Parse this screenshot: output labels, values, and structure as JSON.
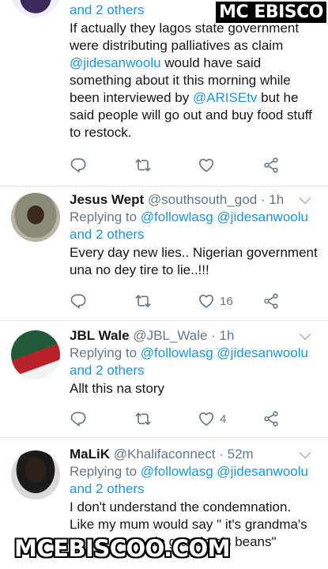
{
  "watermarks": {
    "top": "MC EBISCO",
    "bottom": "MCEBISCOO.COM"
  },
  "tweet1": {
    "reply_tail": "and 2 others",
    "body_1": "If actually they lagos state government were distributing palliatives as claim ",
    "mention_1": "@jidesanwoolu",
    "body_2": " would have said something about it this morning while been interviewed by ",
    "mention_2": "@ARISEtv",
    "body_3": " but he said people will go out and buy food stuff to restock."
  },
  "tweet2": {
    "name": "Jesus Wept",
    "handle": "@southsouth_god",
    "time": "· 1h",
    "replying": "Replying to ",
    "mention_1": "@followlasg",
    "mention_2": "@jidesanwoolu",
    "reply_tail": "and 2 others",
    "body": "Every day new lies.. Nigerian government una no dey tire to lie..!!!",
    "likes": "16"
  },
  "tweet3": {
    "name": "JBL Wale",
    "handle": "@JBL_Wale",
    "time": "· 1h",
    "replying": "Replying to ",
    "mention_1": "@followlasg",
    "mention_2": "@jidesanwoolu",
    "reply_tail": "and 2 others",
    "body": "Allt this na story",
    "likes": "4"
  },
  "tweet4": {
    "name": "MaLiK",
    "handle": "@Khalifaconnect",
    "time": "· 52m",
    "replying": "Replying to ",
    "mention_1": "@followlasg",
    "mention_2": "@jidesanwoolu",
    "reply_tail": "and 2 others",
    "body_1": "I don't understand the condemnation.",
    "body_2": "Like my mum would say \" it's grandma's",
    "body_3": "de grandma's beans\""
  },
  "icons": [
    "reply-icon",
    "retweet-icon",
    "like-icon",
    "share-icon",
    "caret-down-icon"
  ],
  "colors": {
    "link": "#1b95e0",
    "muted": "#657786",
    "divider": "#e1e8ed"
  }
}
